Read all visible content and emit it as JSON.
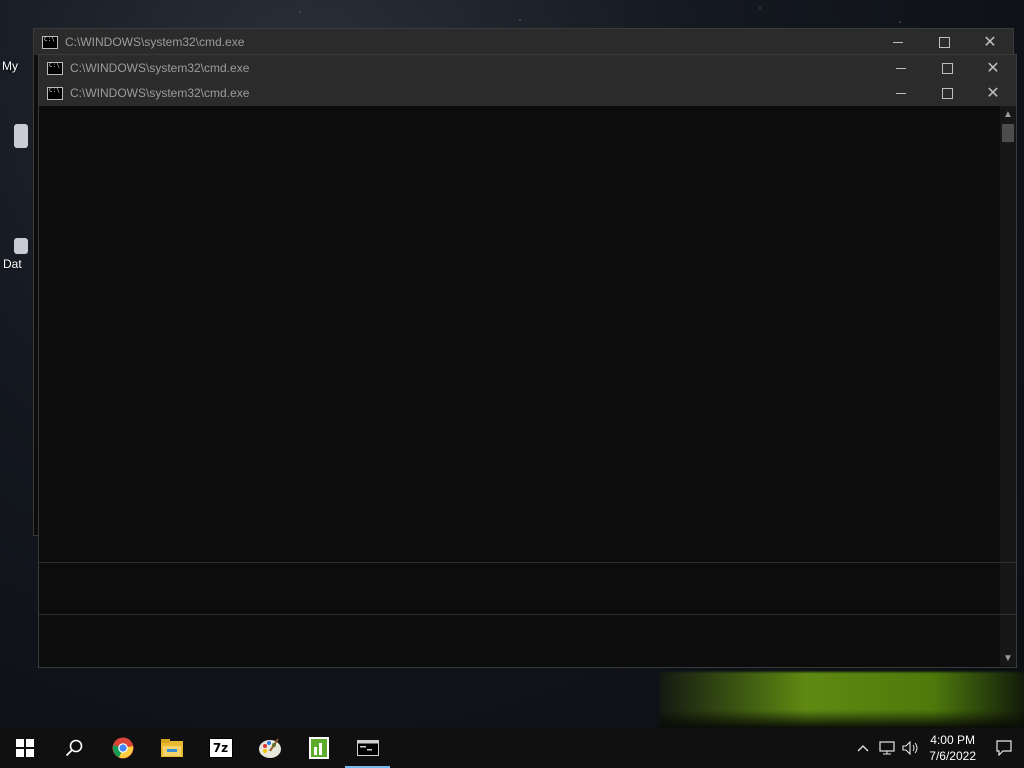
{
  "desktop": {
    "labels": [
      "My",
      "Dat"
    ]
  },
  "windows": [
    {
      "title": "C:\\WINDOWS\\system32\\cmd.exe",
      "controls": {
        "minimize": "—",
        "maximize": "☐",
        "close": "✕"
      }
    },
    {
      "title": "C:\\WINDOWS\\system32\\cmd.exe",
      "controls": {
        "minimize": "—",
        "maximize": "☐",
        "close": "✕"
      }
    },
    {
      "title": "C:\\WINDOWS\\system32\\cmd.exe",
      "controls": {
        "minimize": "—",
        "maximize": "☐",
        "close": "✕"
      }
    }
  ],
  "scroll_arrows": {
    "up": "▲",
    "down": "▼"
  },
  "taskbar": {
    "items": [
      {
        "name": "start",
        "icon": "windows-logo-icon"
      },
      {
        "name": "search",
        "icon": "search-icon"
      },
      {
        "name": "chrome",
        "icon": "chrome-icon"
      },
      {
        "name": "file-explorer",
        "icon": "folder-icon"
      },
      {
        "name": "7zip",
        "icon": "7zip-icon",
        "label": "7z"
      },
      {
        "name": "paint",
        "icon": "palette-icon"
      },
      {
        "name": "notepad",
        "icon": "notepad-chart-icon"
      },
      {
        "name": "cmd",
        "icon": "terminal-icon",
        "active": true
      }
    ],
    "tray": {
      "time": "4:00 PM",
      "date": "7/6/2022",
      "chevron": "^",
      "network": "network-icon",
      "volume": "volume-icon",
      "notifications": "action-center-icon"
    }
  },
  "colors": {
    "titlebar": "#2b2b2b",
    "console_bg": "#0c0c0c",
    "taskbar": "#101010",
    "accent": "#76b9ed"
  }
}
